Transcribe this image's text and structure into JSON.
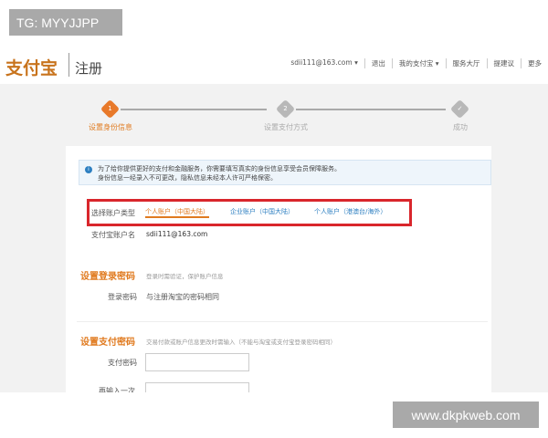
{
  "overlay_tag": "TG: MYYJJPP",
  "watermark": "www.dkpkweb.com",
  "header": {
    "logo": "支付宝",
    "title": "注册",
    "nav": [
      "sdii111@163.com ▾",
      "退出",
      "我的支付宝 ▾",
      "服务大厅",
      "提建议",
      "更多"
    ]
  },
  "steps": [
    {
      "num": "1",
      "label": "设置身份信息",
      "active": true
    },
    {
      "num": "2",
      "label": "设置支付方式",
      "active": false
    },
    {
      "num": "✓",
      "label": "成功",
      "active": false
    }
  ],
  "colors": {
    "accent": "#e07a1f",
    "highlight": "#d9262c",
    "link": "#2d7fc1"
  },
  "info": {
    "line1": "为了给你提供更好的支付和金融服务，你需要填写真实的身份信息享受会员保障服务。",
    "line2": "身份信息一经录入不可更改，隐私信息未经本人许可严格保密。"
  },
  "account_type": {
    "label": "选择账户类型",
    "options": [
      "个人账户（中国大陆）",
      "企业账户（中国大陆）",
      "个人账户（港澳台/海外）"
    ],
    "selected": 0
  },
  "account_name": {
    "label": "支付宝账户名",
    "value": "sdii111@163.com"
  },
  "login_pwd": {
    "title": "设置登录密码",
    "hint": "登录时需验证，保护账户信息",
    "label": "登录密码",
    "value": "与注册淘宝的密码相同"
  },
  "pay_pwd": {
    "title": "设置支付密码",
    "hint": "交易付款或账户信息更改时需输入（不能与淘宝或支付宝登录密码相同）",
    "label": "支付密码",
    "confirm_label": "再输入一次"
  }
}
